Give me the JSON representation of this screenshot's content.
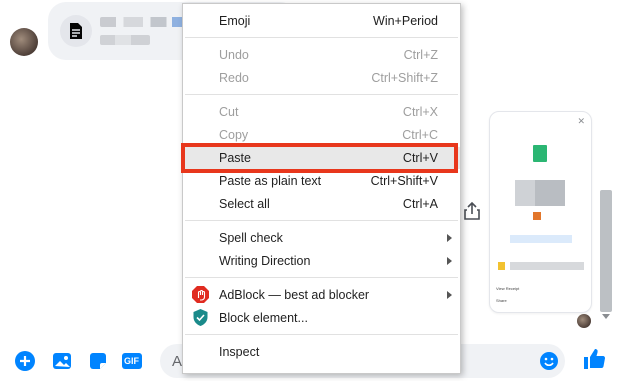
{
  "menu": {
    "emoji": {
      "label": "Emoji",
      "shortcut": "Win+Period"
    },
    "undo": {
      "label": "Undo",
      "shortcut": "Ctrl+Z"
    },
    "redo": {
      "label": "Redo",
      "shortcut": "Ctrl+Shift+Z"
    },
    "cut": {
      "label": "Cut",
      "shortcut": "Ctrl+X"
    },
    "copy": {
      "label": "Copy",
      "shortcut": "Ctrl+C"
    },
    "paste": {
      "label": "Paste",
      "shortcut": "Ctrl+V"
    },
    "paste_plain": {
      "label": "Paste as plain text",
      "shortcut": "Ctrl+Shift+V"
    },
    "select_all": {
      "label": "Select all",
      "shortcut": "Ctrl+A"
    },
    "spell_check": {
      "label": "Spell check"
    },
    "writing_direction": {
      "label": "Writing Direction"
    },
    "adblock": {
      "label": "AdBlock — best ad blocker"
    },
    "block_element": {
      "label": "Block element..."
    },
    "inspect": {
      "label": "Inspect"
    }
  },
  "composer": {
    "placeholder_visible": "Aa",
    "gif_label": "GIF"
  },
  "preview": {
    "row1": "View Receipt",
    "row2": "Share"
  },
  "colors": {
    "accent": "#0084ff",
    "highlight_border": "#e8371c",
    "adblock": "#e02b20",
    "block_element": "#1a8a8a"
  }
}
